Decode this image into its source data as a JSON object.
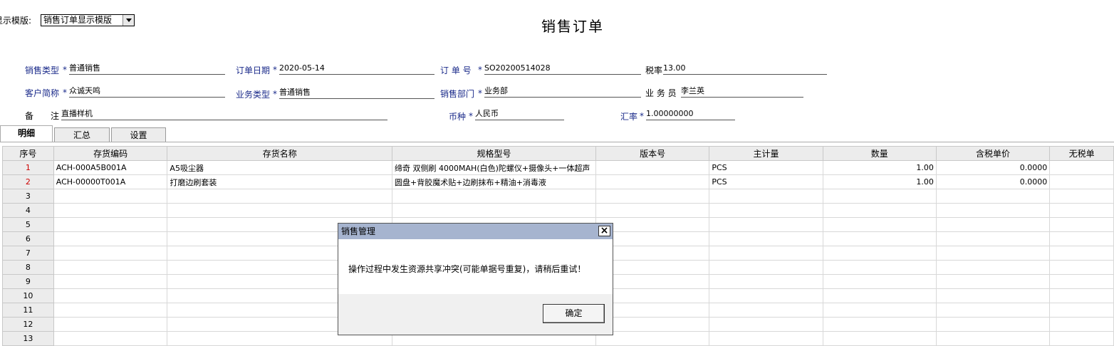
{
  "template": {
    "label": "显示模版:",
    "selected": "销售订单显示模版"
  },
  "title": "销售订单",
  "header": {
    "sale_type": {
      "label": "销售类型",
      "value": "普通销售"
    },
    "order_date": {
      "label": "订单日期",
      "value": "2020-05-14"
    },
    "order_no": {
      "label": "订 单 号",
      "value": "SO20200514028"
    },
    "tax_rate": {
      "label": "税率",
      "value": "13.00"
    },
    "customer": {
      "label": "客户简称",
      "value": "众诚天鸣"
    },
    "biz_type": {
      "label": "业务类型",
      "value": "普通销售"
    },
    "dept": {
      "label": "销售部门",
      "value": "业务部"
    },
    "salesman": {
      "label": "业 务 员",
      "value": "李兰英"
    },
    "remark": {
      "label": "备　　注",
      "value": "直播样机"
    },
    "currency": {
      "label": "币种",
      "value": "人民币"
    },
    "exchange": {
      "label": "汇率",
      "value": "1.00000000"
    },
    "required_mark": "*"
  },
  "tabs": [
    "明细",
    "汇总",
    "设置"
  ],
  "grid": {
    "columns": [
      "序号",
      "存货编码",
      "存货名称",
      "规格型号",
      "版本号",
      "主计量",
      "数量",
      "含税单价",
      "无税单"
    ],
    "rows": [
      {
        "no": "1",
        "code": "ACH-000A5B001A",
        "name": "A5吸尘器",
        "spec": "缔奇 双侧刷 4000MAH(白色)陀螺仪+摄像头+一体超声",
        "version": "",
        "unit": "PCS",
        "qty": "1.00",
        "price": "0.0000"
      },
      {
        "no": "2",
        "code": "ACH-00000T001A",
        "name": "打磨边刷套装",
        "spec": "圆盘+背胶魔术贴+边刷抹布+精油+消毒液",
        "version": "",
        "unit": "PCS",
        "qty": "1.00",
        "price": "0.0000"
      },
      {
        "no": "3"
      },
      {
        "no": "4"
      },
      {
        "no": "5"
      },
      {
        "no": "6"
      },
      {
        "no": "7"
      },
      {
        "no": "8"
      },
      {
        "no": "9"
      },
      {
        "no": "10"
      },
      {
        "no": "11"
      },
      {
        "no": "12"
      },
      {
        "no": "13"
      }
    ]
  },
  "dialog": {
    "title": "销售管理",
    "close": "×",
    "message": "操作过程中发生资源共享冲突(可能单据号重复)，请稍后重试！",
    "ok_label": "确定"
  }
}
